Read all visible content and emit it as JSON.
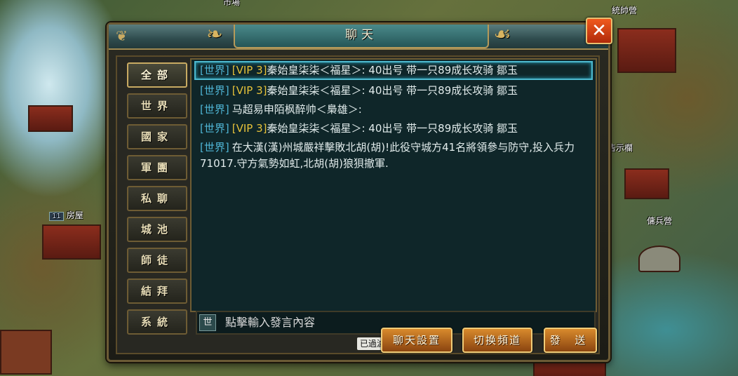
{
  "dialog": {
    "title": "聊天",
    "close_symbol": "✕"
  },
  "tabs": [
    {
      "label": "全部",
      "active": true
    },
    {
      "label": "世界",
      "active": false
    },
    {
      "label": "國家",
      "active": false
    },
    {
      "label": "軍團",
      "active": false
    },
    {
      "label": "私聊",
      "active": false
    },
    {
      "label": "城池",
      "active": false
    },
    {
      "label": "師徒",
      "active": false
    },
    {
      "label": "結拜",
      "active": false
    },
    {
      "label": "系統",
      "active": false
    }
  ],
  "messages": [
    {
      "channel": "[世界]",
      "vip": "[VIP 3]",
      "text": "秦始皇柒柒＜福星＞:  40出号  带一只89成长攻骑 鄒玉",
      "selected": true
    },
    {
      "channel": "[世界]",
      "vip": "[VIP 3]",
      "text": "秦始皇柒柒＜福星＞:  40出号  带一只89成长攻骑 鄒玉",
      "selected": false
    },
    {
      "channel": "[世界]",
      "vip": "",
      "text": "马超易申陌枫醉帅＜梟雄＞:",
      "selected": false
    },
    {
      "channel": "[世界]",
      "vip": "[VIP 3]",
      "text": "秦始皇柒柒＜福星＞:  40出号  带一只89成长攻骑 鄒玉",
      "selected": false
    },
    {
      "channel": "[世界]",
      "vip": "",
      "text": "在大漢(漢)州城嚴祥擊敗北胡(胡)!此役守城方41名將領參与防守,投入兵力71017.守方氣勢如虹,北胡(胡)狼狽撤軍.",
      "selected": false
    }
  ],
  "input": {
    "channel_label": "世",
    "placeholder": "點擊輸入發言內容"
  },
  "filter_tag": "已過濾",
  "buttons": {
    "settings": "聊天設置",
    "switch_channel": "切换頻道",
    "send": "發  送"
  },
  "map_labels": {
    "market": "市場",
    "command_camp": "統帥營",
    "notice": "告示欄",
    "recruit_camp": "傭兵營",
    "house": "房屋",
    "house_level": "11"
  },
  "colors": {
    "channel": "#4fb6d6",
    "vip": "#e6c23a",
    "accent_button": "#d88a2c",
    "close": "#f05a1e"
  }
}
